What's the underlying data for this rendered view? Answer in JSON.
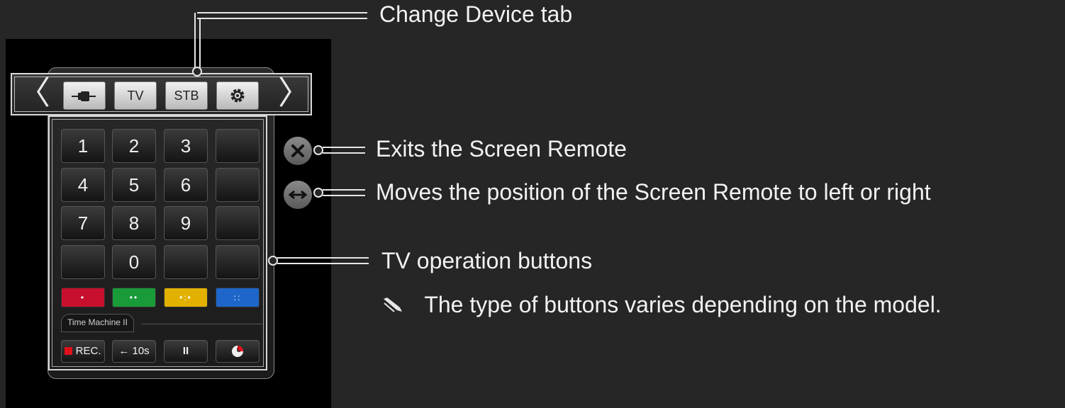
{
  "annotations": {
    "change_device_tab": "Change Device tab",
    "exits": "Exits the Screen Remote",
    "moves": "Moves the position of the Screen Remote to left or right",
    "tv_operation": "TV operation buttons",
    "note": "The type of buttons varies depending on the model."
  },
  "remote": {
    "tabs": [
      {
        "label": "",
        "icon": "input-plug-icon"
      },
      {
        "label": "TV"
      },
      {
        "label": "STB"
      },
      {
        "label": "",
        "icon": "settings-gear-icon"
      }
    ],
    "prev_arrow": "〈",
    "next_arrow": "〉",
    "keys": [
      "1",
      "2",
      "3",
      "",
      "4",
      "5",
      "6",
      "",
      "7",
      "8",
      "9",
      "",
      "",
      "0",
      "",
      ""
    ],
    "color_keys": [
      {
        "name": "red",
        "color": "#c8102e",
        "dots": "•"
      },
      {
        "name": "green",
        "color": "#1a9b3a",
        "dots": "••"
      },
      {
        "name": "yellow",
        "color": "#e2b100",
        "dots": "•:•"
      },
      {
        "name": "blue",
        "color": "#1e66c9",
        "dots": "::"
      }
    ],
    "time_machine_label": "Time Machine II",
    "bottom_keys": {
      "rec": "REC.",
      "back10": "← 10s",
      "pause": "II"
    },
    "exit_icon": "close-icon",
    "move_icon": "left-right-arrows-icon"
  },
  "colors": {
    "background": "#262626",
    "panel": "#000000",
    "rec_red": "#e0101a"
  }
}
